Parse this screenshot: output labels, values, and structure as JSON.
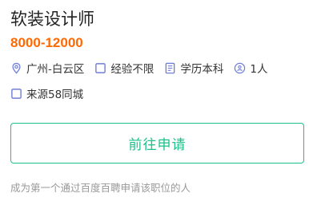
{
  "job": {
    "title": "软装设计师",
    "salary": "8000-12000",
    "location": "广州-白云区",
    "experience": "经验不限",
    "education": "学历本科",
    "headcount": "1人",
    "source": "来源58同城"
  },
  "icons": {
    "location": "location-pin-icon",
    "experience": "checkbox-icon",
    "education": "document-icon",
    "headcount": "person-icon",
    "source": "checkbox-icon"
  },
  "apply_button": {
    "label": "前往申请"
  },
  "footer": {
    "text": "成为第一个通过百度百聘申请该职位的人"
  },
  "colors": {
    "accent": "#1dc289",
    "salary": "#ff6a00",
    "icon": "#6f7ed8",
    "text": "#222222",
    "muted": "#999999"
  }
}
